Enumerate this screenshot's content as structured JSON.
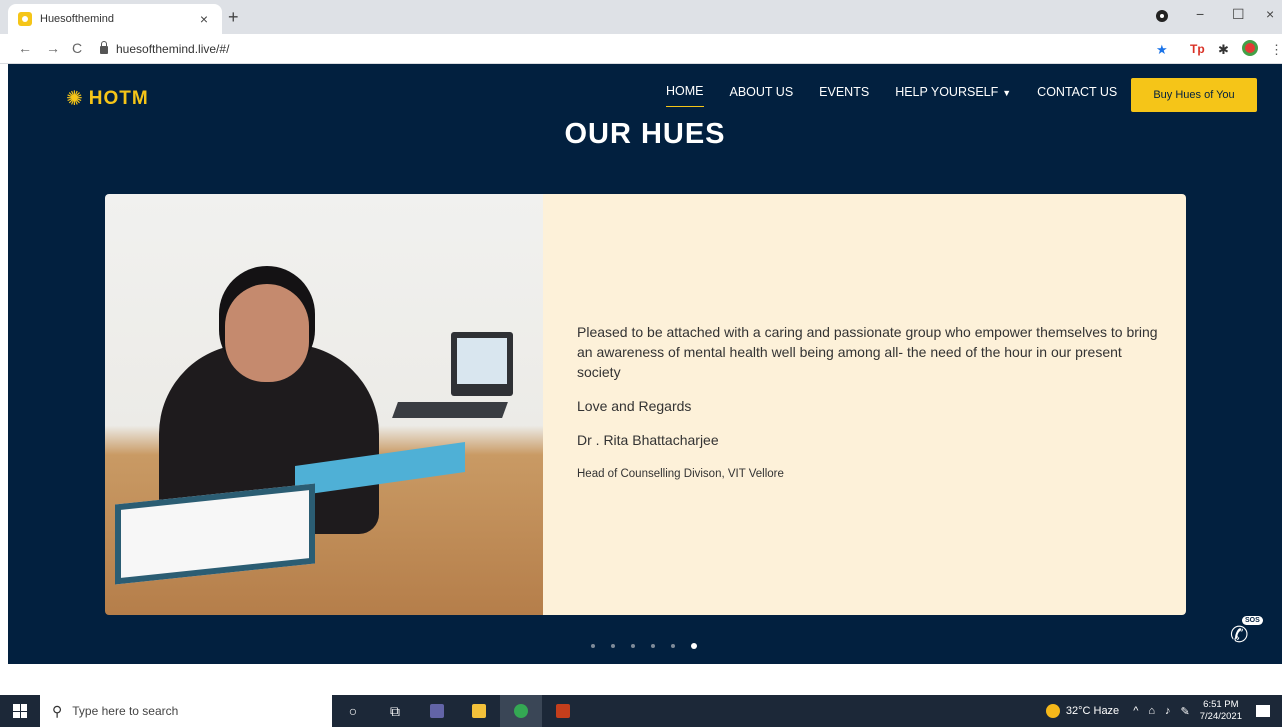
{
  "browser": {
    "tab_title": "Huesofthemind",
    "tab_close": "×",
    "new_tab": "+",
    "url": "huesofthemind.live/#/",
    "back": "←",
    "forward": "→",
    "reload": "C",
    "minimize": "−",
    "maximize": "☐",
    "close": "×"
  },
  "site": {
    "logo_text": "HOTM",
    "nav": [
      {
        "label": "HOME"
      },
      {
        "label": "ABOUT US"
      },
      {
        "label": "EVENTS"
      },
      {
        "label": "HELP YOURSELF"
      },
      {
        "label": "CONTACT US"
      }
    ],
    "cta_label": "Buy Hues of You",
    "heading": "OUR HUES",
    "testimonial": {
      "quote": "Pleased to be attached with a caring and passionate group who empower themselves to bring an awareness of mental health well being among all- the need of the hour in our present society",
      "signoff": "Love and Regards",
      "name": "Dr . Rita Bhattacharjee",
      "role": "Head of Counselling Divison, VIT Vellore"
    },
    "carousel": {
      "total": 6,
      "active_index": 5
    },
    "sos_label": "SOS"
  },
  "taskbar": {
    "search_placeholder": "Type here to search",
    "weather": "32°C  Haze",
    "time": "6:51 PM",
    "date": "7/24/2021"
  },
  "colors": {
    "site_bg": "#02203f",
    "accent": "#f5c518",
    "card_bg": "#fdf1d9"
  }
}
